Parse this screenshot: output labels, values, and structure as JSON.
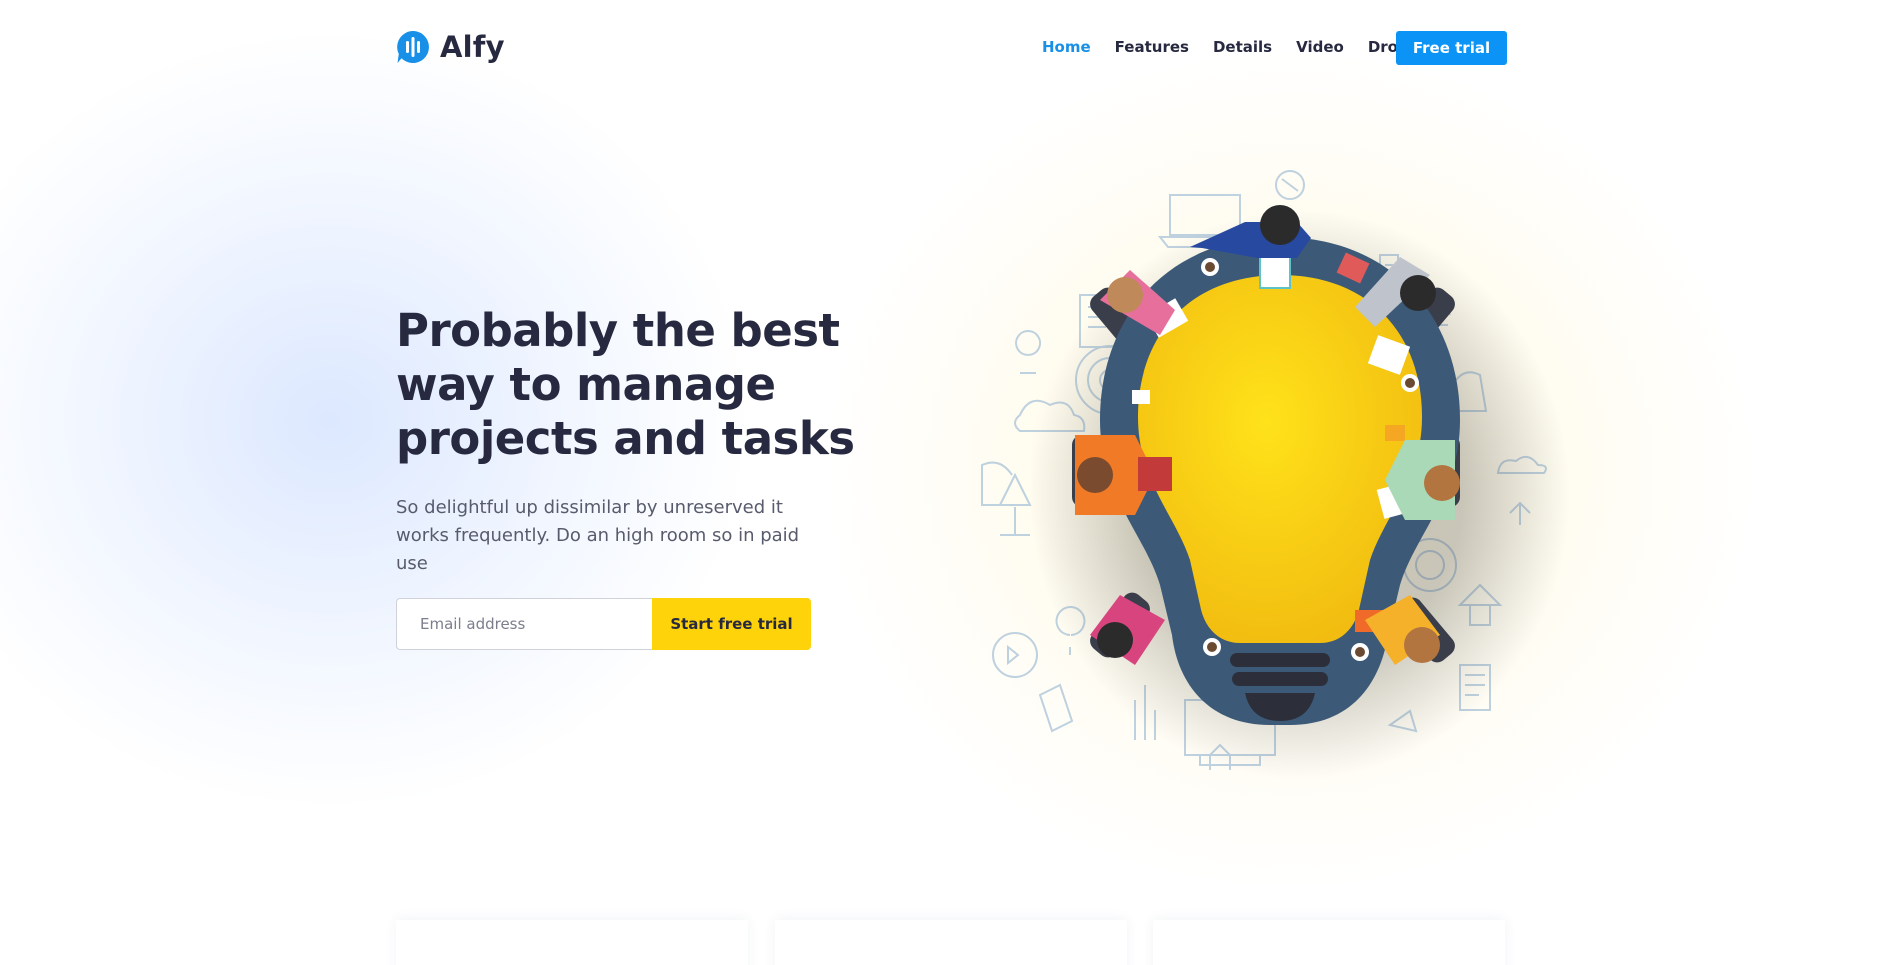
{
  "brand": {
    "name": "Alfy",
    "logo_icon": "sound-bars-bubble-icon",
    "color": "#1890e8"
  },
  "nav": {
    "items": [
      {
        "label": "Home",
        "active": true
      },
      {
        "label": "Features",
        "active": false
      },
      {
        "label": "Details",
        "active": false
      },
      {
        "label": "Video",
        "active": false
      },
      {
        "label": "Drop",
        "active": false,
        "dropdown": true
      }
    ],
    "cta_label": "Free trial"
  },
  "hero": {
    "title": "Probably the best way to manage projects and tasks",
    "subtitle": "So delightful up dissimilar by unreserved it works frequently. Do an high room so in paid use",
    "email_placeholder": "Email address",
    "cta_label": "Start free trial"
  },
  "illustration": {
    "name": "team-meeting-lightbulb-table"
  },
  "colors": {
    "heading": "#26293f",
    "primary": "#0b93f6",
    "accent_yellow": "#ffd30a",
    "text_muted": "#585b6c"
  }
}
